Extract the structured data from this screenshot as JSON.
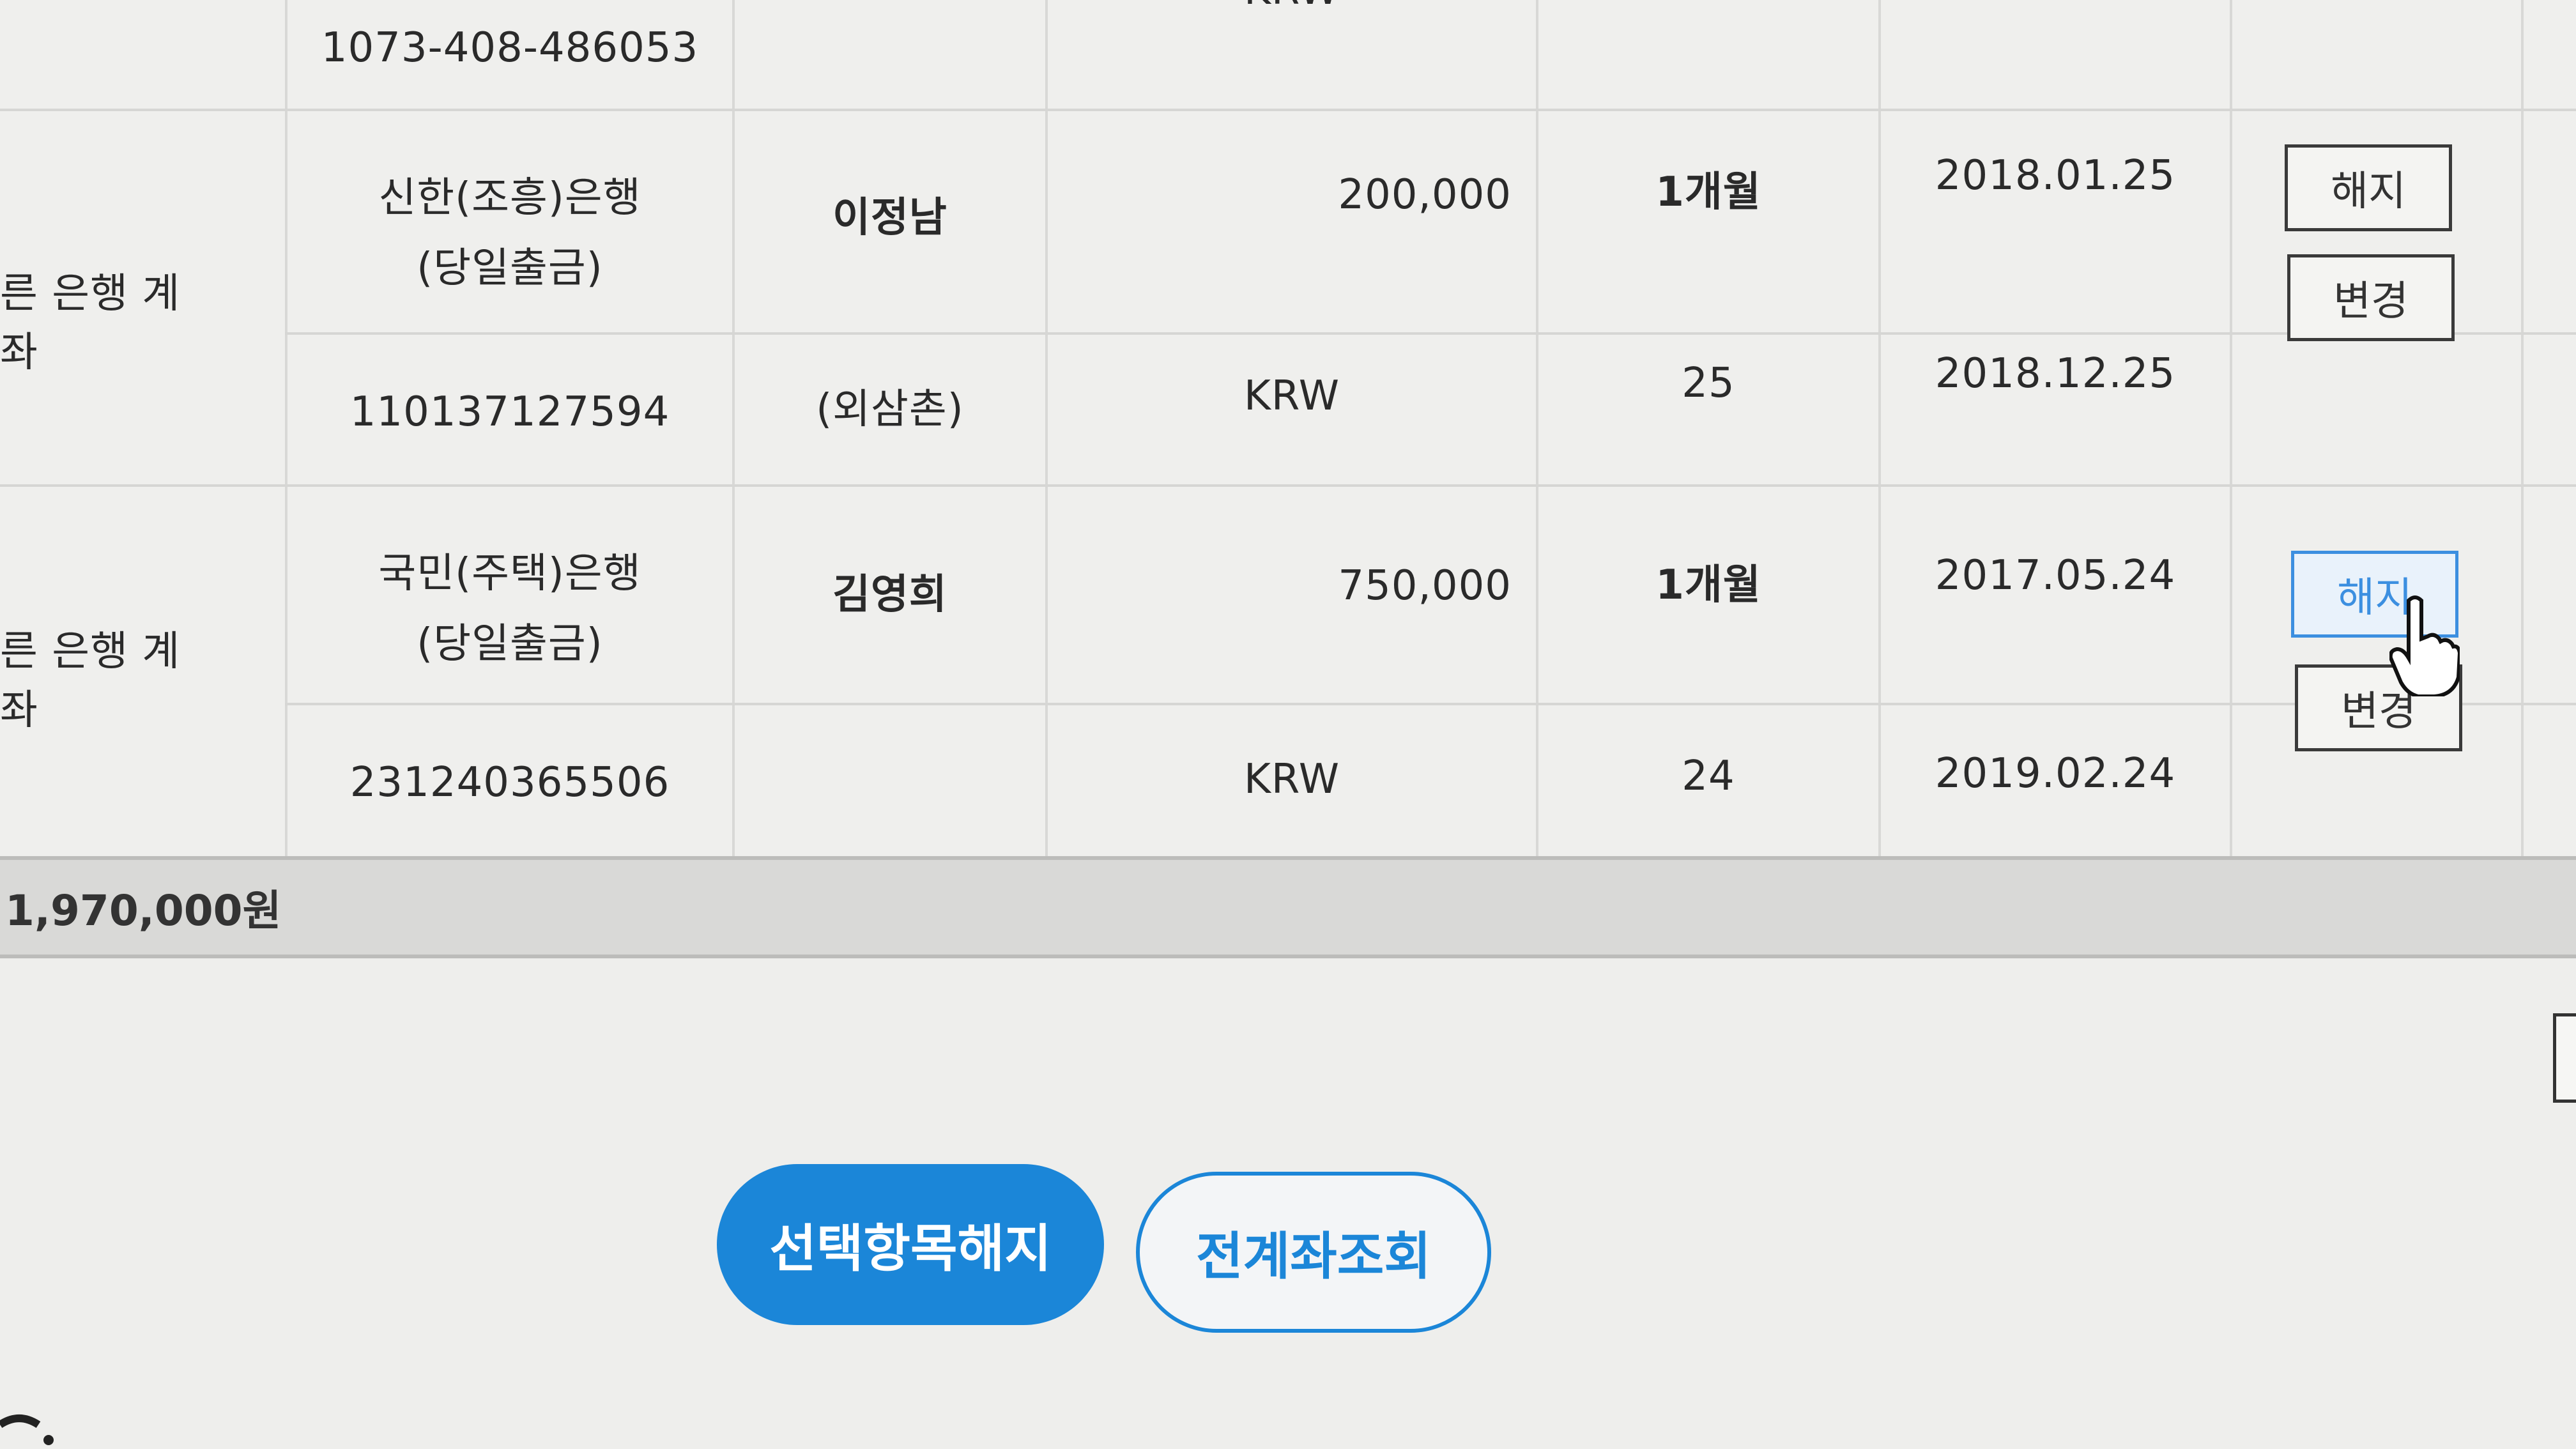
{
  "rows_top_partial": {
    "account_no": "1073-408-486053",
    "currency": "KRW"
  },
  "groups": [
    {
      "type_label": "른 은행 계좌",
      "bank_line1": "신한(조흥)은행",
      "bank_line2": "(당일출금)",
      "account_no": "110137127594",
      "holder": "이정남",
      "holder_sub": "(외삼촌)",
      "amount": "200,000",
      "currency": "KRW",
      "cycle": "1개월",
      "day": "25",
      "start_date": "2018.01.25",
      "end_date": "2018.12.25",
      "cancel_label": "해지",
      "change_label": "변경"
    },
    {
      "type_label": "른 은행 계좌",
      "bank_line1": "국민(주택)은행",
      "bank_line2": "(당일출금)",
      "account_no": "231240365506",
      "holder": "김영희",
      "holder_sub": "",
      "amount": "750,000",
      "currency": "KRW",
      "cycle": "1개월",
      "day": "24",
      "start_date": "2017.05.24",
      "end_date": "2019.02.24",
      "cancel_label": "해지",
      "change_label": "변경"
    }
  ],
  "total": "1,970,000원",
  "actions": {
    "cancel_selected": "선택항목해지",
    "view_all_accounts": "전계좌조회"
  },
  "colors": {
    "primary": "#1b86d8",
    "active_button": "#3c8fe0"
  }
}
